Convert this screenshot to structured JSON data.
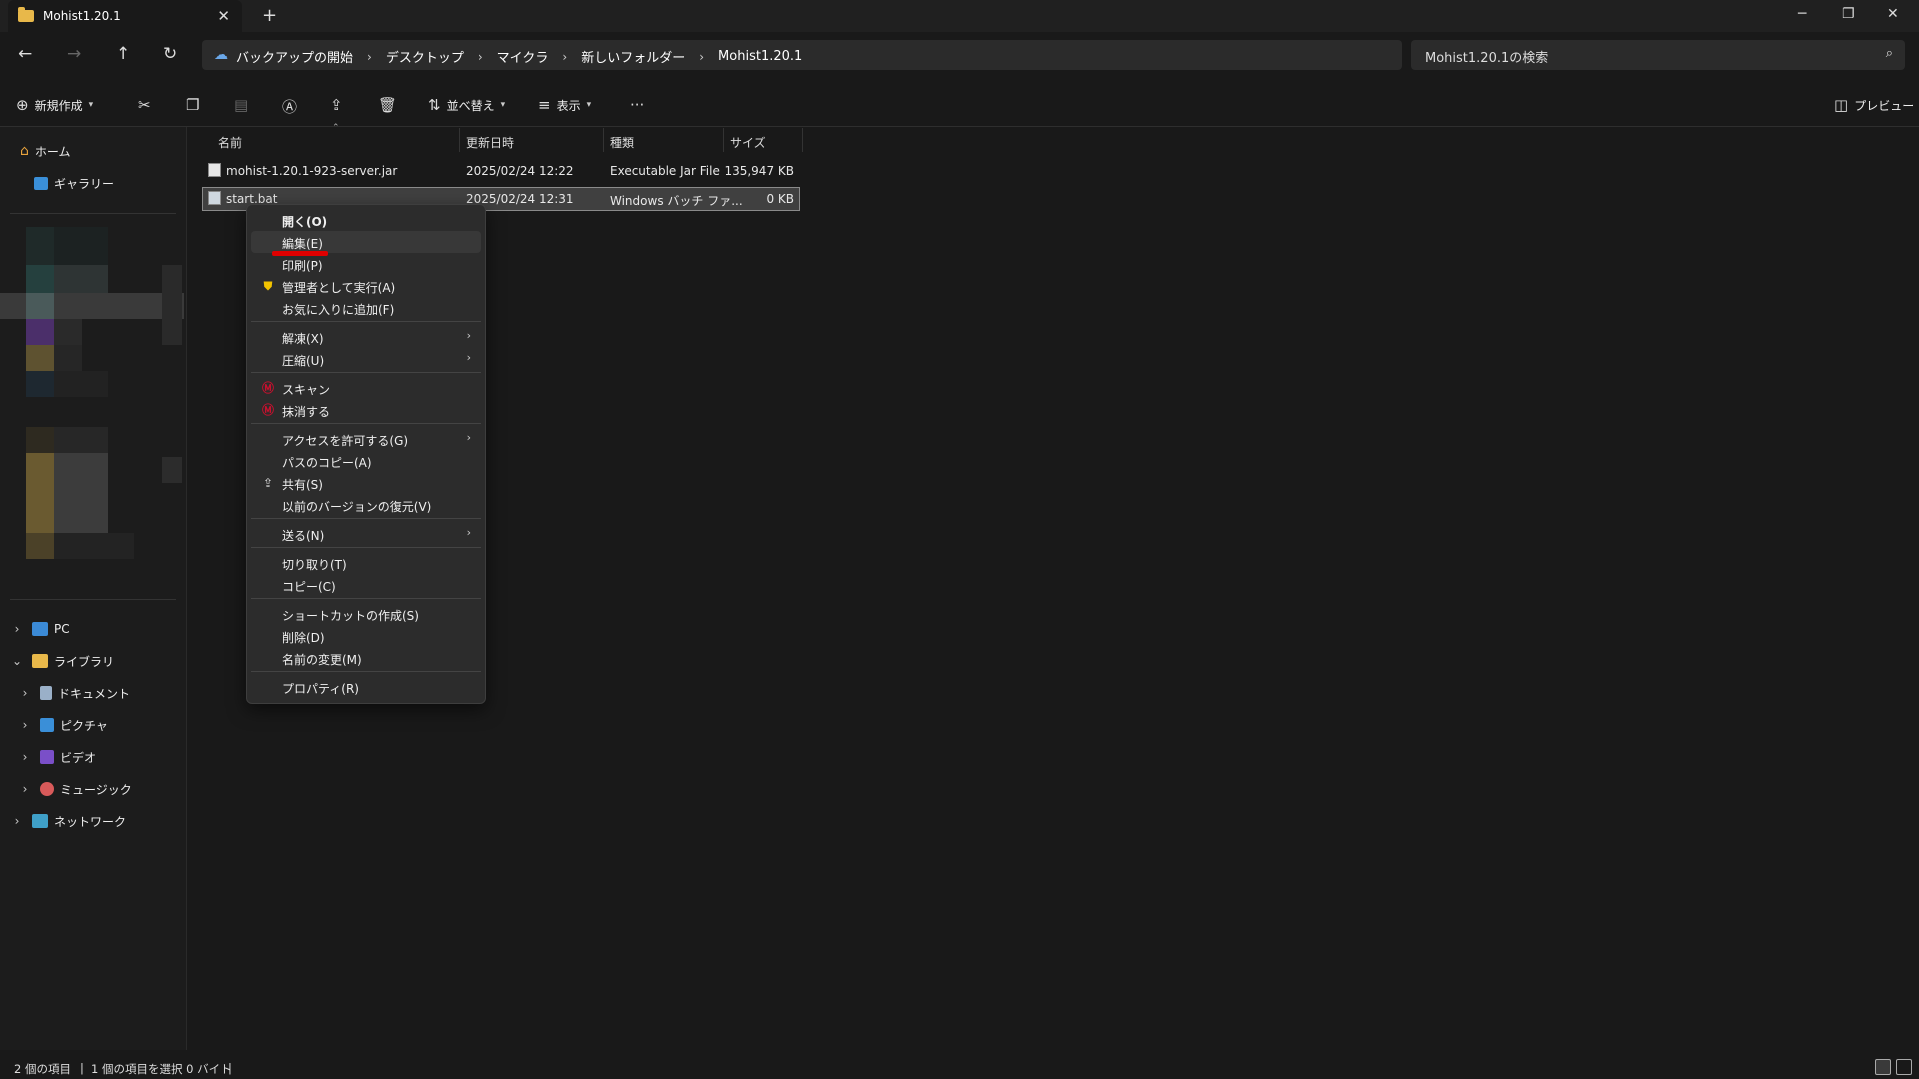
{
  "window": {
    "tab_title": "Mohist1.20.1",
    "new_tab": "+",
    "tab_close": "✕",
    "minimize": "─",
    "maximize": "❐",
    "close": "✕"
  },
  "nav": {
    "back": "←",
    "forward": "→",
    "up": "↑",
    "refresh": "↻",
    "breadcrumbs": [
      "バックアップの開始",
      "デスクトップ",
      "マイクラ",
      "新しいフォルダー",
      "Mohist1.20.1"
    ],
    "separator": "›",
    "search_placeholder": "Mohist1.20.1の検索"
  },
  "toolbar": {
    "new_label": "新規作成",
    "sort_label": "並べ替え",
    "view_label": "表示",
    "more": "···",
    "preview_label": "プレビュー"
  },
  "sidebar": {
    "home": "ホーム",
    "gallery": "ギャラリー",
    "pc": "PC",
    "library": "ライブラリ",
    "documents": "ドキュメント",
    "pictures": "ピクチャ",
    "videos": "ビデオ",
    "music": "ミュージック",
    "network": "ネットワーク"
  },
  "columns": {
    "name": "名前",
    "modified": "更新日時",
    "type": "種類",
    "size": "サイズ"
  },
  "files": [
    {
      "name": "mohist-1.20.1-923-server.jar",
      "modified": "2025/02/24 12:22",
      "type": "Executable Jar File",
      "size": "135,947 KB"
    },
    {
      "name": "start.bat",
      "modified": "2025/02/24 12:31",
      "type": "Windows バッチ ファ...",
      "size": "0 KB"
    }
  ],
  "context_menu": {
    "open": "開く(O)",
    "edit": "編集(E)",
    "print": "印刷(P)",
    "run_as_admin": "管理者として実行(A)",
    "add_favorites": "お気に入りに追加(F)",
    "extract": "解凍(X)",
    "compress": "圧縮(U)",
    "scan": "スキャン",
    "shred": "抹消する",
    "grant_access": "アクセスを許可する(G)",
    "copy_path": "パスのコピー(A)",
    "share": "共有(S)",
    "restore_previous": "以前のバージョンの復元(V)",
    "send_to": "送る(N)",
    "cut": "切り取り(T)",
    "copy": "コピー(C)",
    "create_shortcut": "ショートカットの作成(S)",
    "delete": "削除(D)",
    "rename": "名前の変更(M)",
    "properties": "プロパティ(R)"
  },
  "status": {
    "item_count": "2 個の項目",
    "selection": "1 個の項目を選択  0 バイト"
  },
  "colors": {
    "background": "#191919",
    "menu_bg": "#2c2c2c",
    "selection": "#404040",
    "annotation_red": "#e00000",
    "folder_yellow": "#e8b84a",
    "mcafee_red": "#c8102e"
  }
}
